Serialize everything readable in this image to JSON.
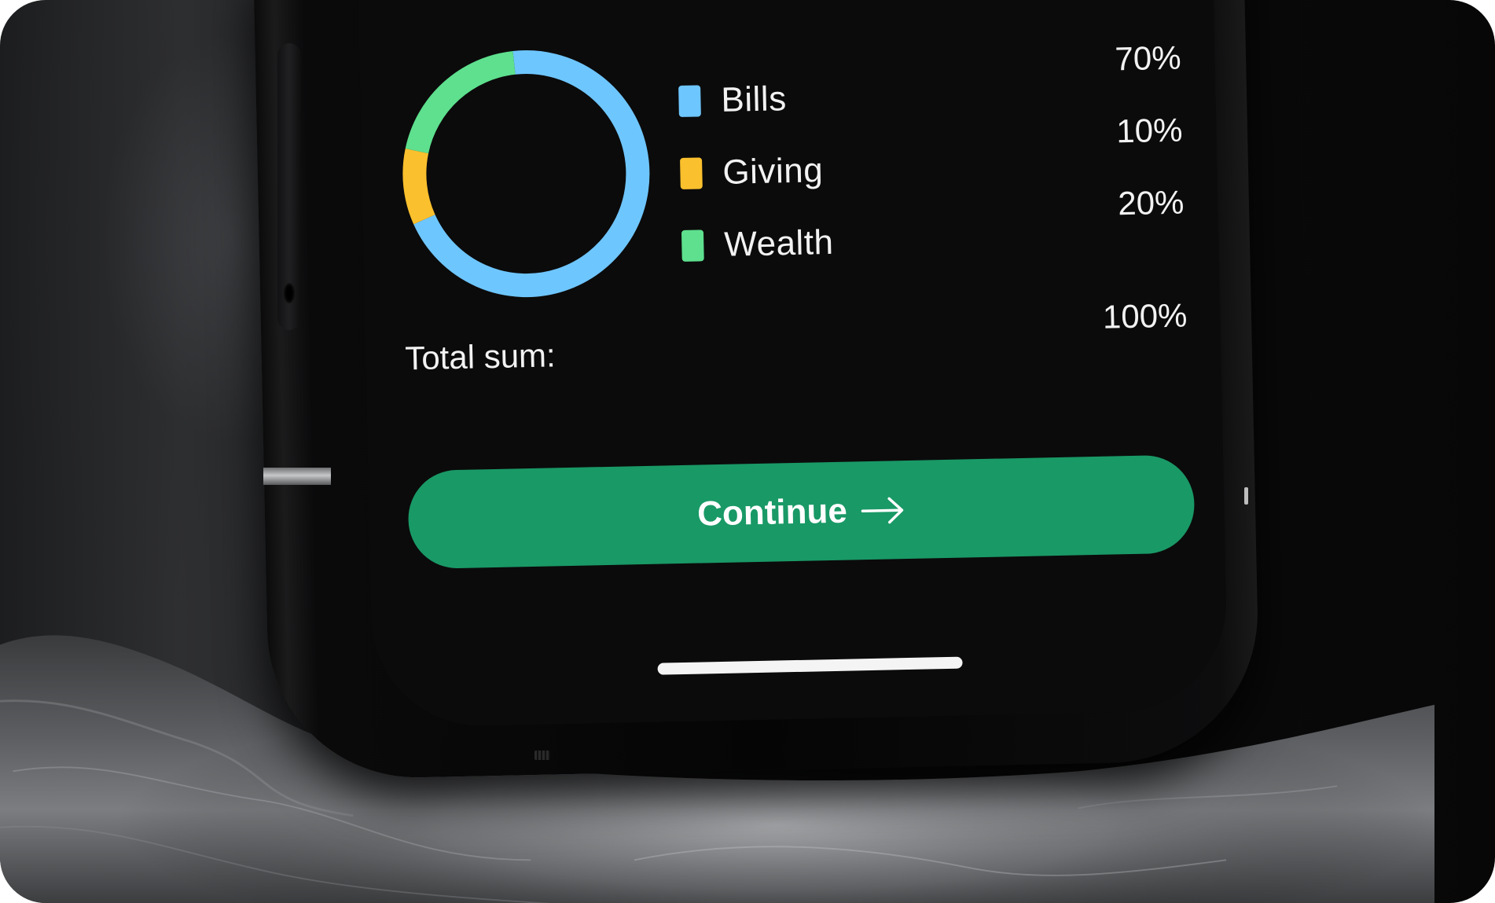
{
  "chart_data": {
    "type": "pie",
    "categories": [
      "Bills",
      "Giving",
      "Wealth"
    ],
    "values": [
      70,
      10,
      20
    ],
    "colors": [
      "#6EC6FF",
      "#FBC02D",
      "#5EE08E"
    ],
    "style": "donut"
  },
  "legend": {
    "items": [
      {
        "label": "Bills",
        "value": "70%",
        "color": "#6EC6FF"
      },
      {
        "label": "Giving",
        "value": "10%",
        "color": "#FBC02D"
      },
      {
        "label": "Wealth",
        "value": "20%",
        "color": "#5EE08E"
      }
    ]
  },
  "total": {
    "label": "Total sum:",
    "value": "100%"
  },
  "actions": {
    "continue_label": "Continue",
    "continue_icon": "arrow-right-icon",
    "accent_color": "#199966"
  }
}
